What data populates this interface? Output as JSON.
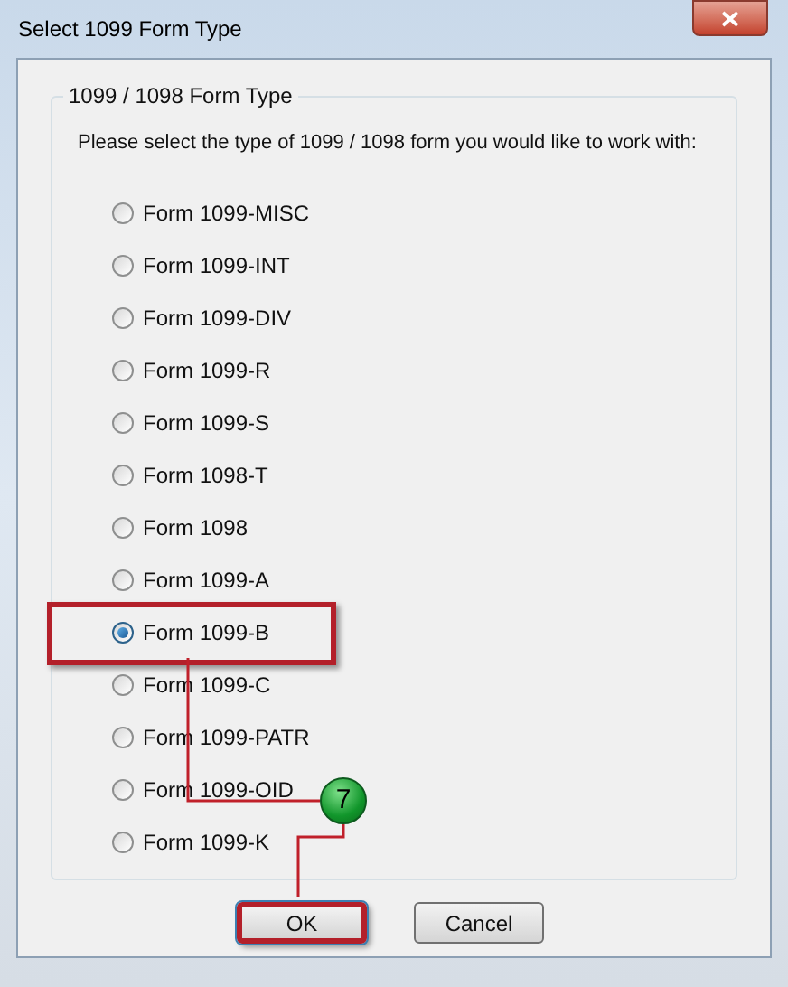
{
  "window": {
    "title": "Select 1099 Form Type"
  },
  "group": {
    "title": "1099 / 1098 Form Type",
    "instruction": "Please select the type of 1099 / 1098 form you would like to work with:"
  },
  "options": [
    {
      "label": "Form 1099-MISC",
      "selected": false
    },
    {
      "label": "Form 1099-INT",
      "selected": false
    },
    {
      "label": "Form 1099-DIV",
      "selected": false
    },
    {
      "label": "Form 1099-R",
      "selected": false
    },
    {
      "label": "Form 1099-S",
      "selected": false
    },
    {
      "label": "Form 1098-T",
      "selected": false
    },
    {
      "label": "Form 1098",
      "selected": false
    },
    {
      "label": "Form 1099-A",
      "selected": false
    },
    {
      "label": "Form 1099-B",
      "selected": true
    },
    {
      "label": "Form 1099-C",
      "selected": false
    },
    {
      "label": "Form 1099-PATR",
      "selected": false
    },
    {
      "label": "Form 1099-OID",
      "selected": false
    },
    {
      "label": "Form 1099-K",
      "selected": false
    }
  ],
  "buttons": [
    {
      "label": "OK",
      "highlighted": true
    },
    {
      "label": "Cancel",
      "highlighted": false
    }
  ],
  "callout": {
    "number": "7"
  }
}
